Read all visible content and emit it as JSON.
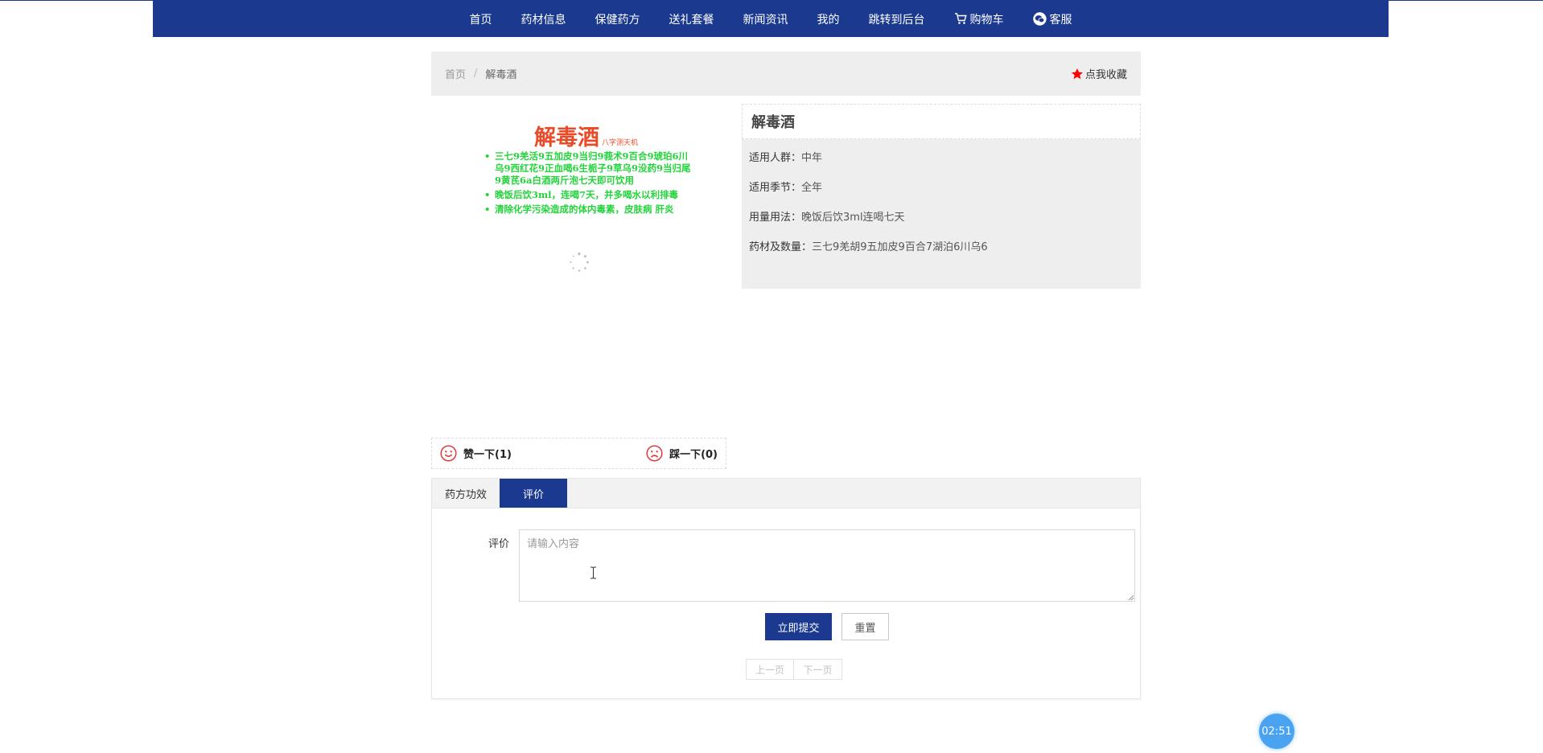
{
  "nav": {
    "items": [
      "首页",
      "药材信息",
      "保健药方",
      "送礼套餐",
      "新闻资讯",
      "我的",
      "跳转到后台"
    ],
    "cart_label": "购物车",
    "service_label": "客服"
  },
  "breadcrumb": {
    "home": "首页",
    "separator": "/",
    "current": "解毒酒"
  },
  "favorite": {
    "label": "点我收藏"
  },
  "product_image": {
    "title": "解毒酒",
    "subtitle": "八字测天机",
    "bullets": [
      "三七9羌活9五加皮9当归9莪术9百合9琥珀6川乌9西红花9正血喝6生栀子9草乌9没药9当归尾9黄芪6a白酒两斤泡七天即可饮用",
      "晚饭后饮3ml，连喝7天，并多喝水以利排毒",
      "清除化学污染造成的体内毒素，皮肤病 肝炎"
    ]
  },
  "product": {
    "name": "解毒酒",
    "fields": [
      {
        "label": "适用人群：",
        "value": "中年"
      },
      {
        "label": "适用季节：",
        "value": "全年"
      },
      {
        "label": "用量用法：",
        "value": "晚饭后饮3ml连喝七天"
      },
      {
        "label": "药材及数量：",
        "value": "三七9羌胡9五加皮9百合7湖泊6川乌6"
      }
    ]
  },
  "vote": {
    "like": "赞一下(1)",
    "dislike": "踩一下(0)"
  },
  "tabs": [
    {
      "label": "药方功效",
      "active": false
    },
    {
      "label": "评价",
      "active": true
    }
  ],
  "comment_form": {
    "label": "评价",
    "placeholder": "请输入内容",
    "value": "",
    "submit": "立即提交",
    "reset": "重置"
  },
  "pager": {
    "prev": "上一页",
    "next": "下一页"
  },
  "timer": "02:51",
  "colors": {
    "primary": "#1b3a8f",
    "star": "#ff0000",
    "title_red": "#e94b28",
    "bullet_green": "#22d43a",
    "face_red": "#e03b3b",
    "timer_blue": "#4aa3f0"
  }
}
